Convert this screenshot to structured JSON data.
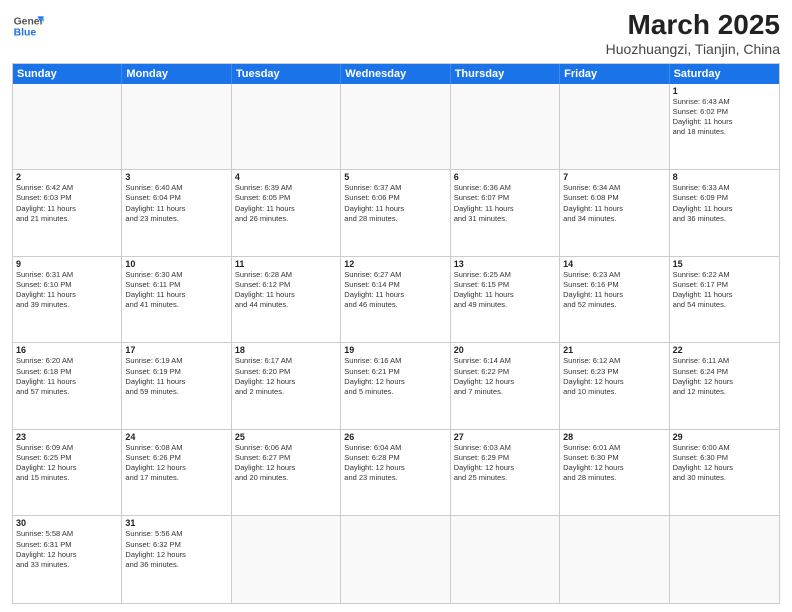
{
  "header": {
    "logo_general": "General",
    "logo_blue": "Blue",
    "title": "March 2025",
    "subtitle": "Huozhuangzi, Tianjin, China"
  },
  "weekdays": [
    "Sunday",
    "Monday",
    "Tuesday",
    "Wednesday",
    "Thursday",
    "Friday",
    "Saturday"
  ],
  "weeks": [
    [
      {
        "day": "",
        "info": ""
      },
      {
        "day": "",
        "info": ""
      },
      {
        "day": "",
        "info": ""
      },
      {
        "day": "",
        "info": ""
      },
      {
        "day": "",
        "info": ""
      },
      {
        "day": "",
        "info": ""
      },
      {
        "day": "1",
        "info": "Sunrise: 6:43 AM\nSunset: 6:02 PM\nDaylight: 11 hours\nand 18 minutes."
      }
    ],
    [
      {
        "day": "2",
        "info": "Sunrise: 6:42 AM\nSunset: 6:03 PM\nDaylight: 11 hours\nand 21 minutes."
      },
      {
        "day": "3",
        "info": "Sunrise: 6:40 AM\nSunset: 6:04 PM\nDaylight: 11 hours\nand 23 minutes."
      },
      {
        "day": "4",
        "info": "Sunrise: 6:39 AM\nSunset: 6:05 PM\nDaylight: 11 hours\nand 26 minutes."
      },
      {
        "day": "5",
        "info": "Sunrise: 6:37 AM\nSunset: 6:06 PM\nDaylight: 11 hours\nand 28 minutes."
      },
      {
        "day": "6",
        "info": "Sunrise: 6:36 AM\nSunset: 6:07 PM\nDaylight: 11 hours\nand 31 minutes."
      },
      {
        "day": "7",
        "info": "Sunrise: 6:34 AM\nSunset: 6:08 PM\nDaylight: 11 hours\nand 34 minutes."
      },
      {
        "day": "8",
        "info": "Sunrise: 6:33 AM\nSunset: 6:09 PM\nDaylight: 11 hours\nand 36 minutes."
      }
    ],
    [
      {
        "day": "9",
        "info": "Sunrise: 6:31 AM\nSunset: 6:10 PM\nDaylight: 11 hours\nand 39 minutes."
      },
      {
        "day": "10",
        "info": "Sunrise: 6:30 AM\nSunset: 6:11 PM\nDaylight: 11 hours\nand 41 minutes."
      },
      {
        "day": "11",
        "info": "Sunrise: 6:28 AM\nSunset: 6:12 PM\nDaylight: 11 hours\nand 44 minutes."
      },
      {
        "day": "12",
        "info": "Sunrise: 6:27 AM\nSunset: 6:14 PM\nDaylight: 11 hours\nand 46 minutes."
      },
      {
        "day": "13",
        "info": "Sunrise: 6:25 AM\nSunset: 6:15 PM\nDaylight: 11 hours\nand 49 minutes."
      },
      {
        "day": "14",
        "info": "Sunrise: 6:23 AM\nSunset: 6:16 PM\nDaylight: 11 hours\nand 52 minutes."
      },
      {
        "day": "15",
        "info": "Sunrise: 6:22 AM\nSunset: 6:17 PM\nDaylight: 11 hours\nand 54 minutes."
      }
    ],
    [
      {
        "day": "16",
        "info": "Sunrise: 6:20 AM\nSunset: 6:18 PM\nDaylight: 11 hours\nand 57 minutes."
      },
      {
        "day": "17",
        "info": "Sunrise: 6:19 AM\nSunset: 6:19 PM\nDaylight: 11 hours\nand 59 minutes."
      },
      {
        "day": "18",
        "info": "Sunrise: 6:17 AM\nSunset: 6:20 PM\nDaylight: 12 hours\nand 2 minutes."
      },
      {
        "day": "19",
        "info": "Sunrise: 6:16 AM\nSunset: 6:21 PM\nDaylight: 12 hours\nand 5 minutes."
      },
      {
        "day": "20",
        "info": "Sunrise: 6:14 AM\nSunset: 6:22 PM\nDaylight: 12 hours\nand 7 minutes."
      },
      {
        "day": "21",
        "info": "Sunrise: 6:12 AM\nSunset: 6:23 PM\nDaylight: 12 hours\nand 10 minutes."
      },
      {
        "day": "22",
        "info": "Sunrise: 6:11 AM\nSunset: 6:24 PM\nDaylight: 12 hours\nand 12 minutes."
      }
    ],
    [
      {
        "day": "23",
        "info": "Sunrise: 6:09 AM\nSunset: 6:25 PM\nDaylight: 12 hours\nand 15 minutes."
      },
      {
        "day": "24",
        "info": "Sunrise: 6:08 AM\nSunset: 6:26 PM\nDaylight: 12 hours\nand 17 minutes."
      },
      {
        "day": "25",
        "info": "Sunrise: 6:06 AM\nSunset: 6:27 PM\nDaylight: 12 hours\nand 20 minutes."
      },
      {
        "day": "26",
        "info": "Sunrise: 6:04 AM\nSunset: 6:28 PM\nDaylight: 12 hours\nand 23 minutes."
      },
      {
        "day": "27",
        "info": "Sunrise: 6:03 AM\nSunset: 6:29 PM\nDaylight: 12 hours\nand 25 minutes."
      },
      {
        "day": "28",
        "info": "Sunrise: 6:01 AM\nSunset: 6:30 PM\nDaylight: 12 hours\nand 28 minutes."
      },
      {
        "day": "29",
        "info": "Sunrise: 6:00 AM\nSunset: 6:30 PM\nDaylight: 12 hours\nand 30 minutes."
      }
    ],
    [
      {
        "day": "30",
        "info": "Sunrise: 5:58 AM\nSunset: 6:31 PM\nDaylight: 12 hours\nand 33 minutes."
      },
      {
        "day": "31",
        "info": "Sunrise: 5:56 AM\nSunset: 6:32 PM\nDaylight: 12 hours\nand 36 minutes."
      },
      {
        "day": "",
        "info": ""
      },
      {
        "day": "",
        "info": ""
      },
      {
        "day": "",
        "info": ""
      },
      {
        "day": "",
        "info": ""
      },
      {
        "day": "",
        "info": ""
      }
    ]
  ]
}
